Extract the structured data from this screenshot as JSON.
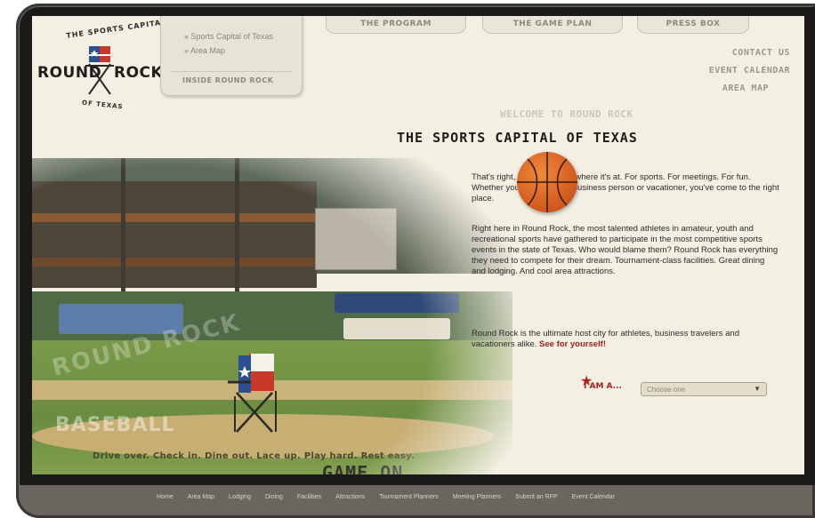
{
  "logo": {
    "arc_top": "THE SPORTS CAPITAL",
    "name_left": "ROUND",
    "name_right": "ROCK",
    "arc_bottom": "OF TEXAS"
  },
  "nav_dropdown": {
    "items": [
      "» Sports Capital of Texas",
      "» Area Map"
    ],
    "inside": "INSIDE ROUND ROCK"
  },
  "tabs": [
    "THE PROGRAM",
    "THE GAME PLAN",
    "PRESS BOX"
  ],
  "utility_links": [
    "CONTACT US",
    "EVENT CALENDAR",
    "AREA MAP"
  ],
  "hero": {
    "watermark_top": "ROUND ROCK",
    "watermark_bottom": "BASEBALL",
    "tagline": "Drive over. Check in. Dine out. Lace up. Play hard. Rest easy.",
    "slogan": "GAME ON."
  },
  "content": {
    "welcome": "WELCOME TO ROUND ROCK",
    "headline": "THE SPORTS CAPITAL OF TEXAS",
    "para1": "That's right, Round Rock is where it's at. For sports. For meetings. For fun. Whether you're an athlete, business person or vacationer, you've come to the right place.",
    "para2": "Right here in Round Rock, the most talented athletes in amateur, youth and recreational sports have gathered to participate in the most competitive sports events in the state of Texas. Who would blame them? Round Rock has everything they need to compete for their dream. Tournament-class facilities. Great dining and lodging. And cool area attractions.",
    "para3_text": "Round Rock is the ultimate host city for athletes, business travelers and vacationers alike. ",
    "para3_cta": "See for yourself!"
  },
  "iam": {
    "label": "I AM A...",
    "select_value": "Choose one"
  },
  "footer_links": [
    "Home",
    "Area Map",
    "Lodging",
    "Dining",
    "Facilities",
    "Attractions",
    "Tournament Planners",
    "Meeting Planners",
    "Submit an RFP",
    "Event Calendar"
  ],
  "colors": {
    "accent_red": "#a8211a",
    "page_bg": "#f3efe3",
    "frame": "#6b6560"
  }
}
